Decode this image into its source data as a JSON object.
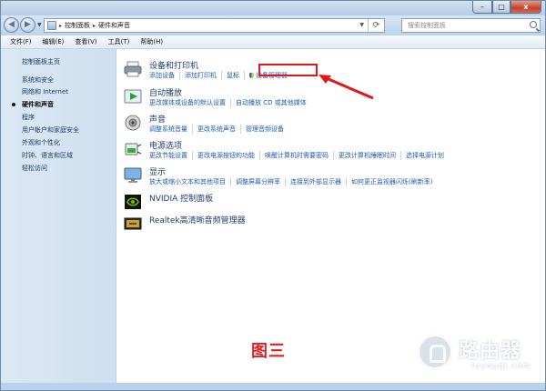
{
  "navigation": {
    "back_glyph": "◀",
    "forward_glyph": "▶",
    "breadcrumb": [
      "控制面板",
      "硬件和声音"
    ],
    "separator": "▸",
    "search_placeholder": "搜索控制面板",
    "caption": {
      "minimize": "–",
      "maximize": "□",
      "close": "x"
    }
  },
  "menu": [
    "文件(F)",
    "编辑(E)",
    "查看(V)",
    "工具(T)",
    "帮助(H)"
  ],
  "sidebar": {
    "items": [
      {
        "label": "控制面板主页",
        "current": false
      },
      {
        "label": "系统和安全",
        "current": false
      },
      {
        "label": "网络和 Internet",
        "current": false
      },
      {
        "label": "硬件和声音",
        "current": true
      },
      {
        "label": "程序",
        "current": false
      },
      {
        "label": "用户帐户和家庭安全",
        "current": false
      },
      {
        "label": "外观和个性化",
        "current": false
      },
      {
        "label": "时钟、语言和区域",
        "current": false
      },
      {
        "label": "轻松访问",
        "current": false
      }
    ]
  },
  "categories": [
    {
      "title": "设备和打印机",
      "icon": "printer-icon",
      "links": [
        "添加设备",
        "添加打印机",
        "鼠标",
        "设备管理器"
      ]
    },
    {
      "title": "自动播放",
      "icon": "autoplay-icon",
      "links": [
        "更改媒体或设备的默认设置",
        "自动播放 CD 或其他媒体"
      ]
    },
    {
      "title": "声音",
      "icon": "speaker-icon",
      "links": [
        "调整系统音量",
        "更改系统声音",
        "管理音频设备"
      ]
    },
    {
      "title": "电源选项",
      "icon": "power-icon",
      "links": [
        "更改节能设置",
        "更改电源按钮的功能",
        "唤醒计算机时需要密码",
        "更改计算机睡眠时间",
        "选择电源计划"
      ]
    },
    {
      "title": "显示",
      "icon": "display-icon",
      "links": [
        "放大或缩小文本和其他项目",
        "调整屏幕分辨率",
        "连接到外部显示器",
        "如何更正监视器闪烁(刷新率)"
      ]
    },
    {
      "title": "NVIDIA 控制面板",
      "icon": "nvidia-icon",
      "links": []
    },
    {
      "title": "Realtek高清晰音频管理器",
      "icon": "realtek-icon",
      "links": []
    }
  ],
  "annotation": {
    "caption": "图三",
    "color": "#e41f1f"
  },
  "watermark": {
    "name": "路由器",
    "domain": "luyouqi.com"
  },
  "colors": {
    "link": "#1d5bb5",
    "category_title": "#1e3d6d",
    "sidebar_bg": "#dbe8f6"
  }
}
